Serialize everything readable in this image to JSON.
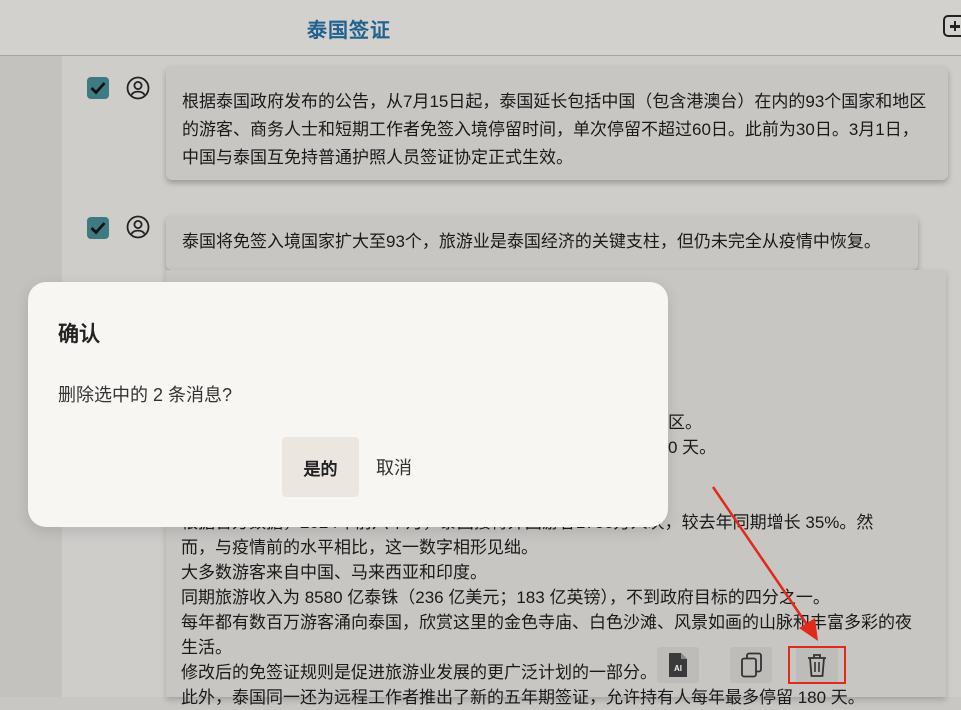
{
  "header": {
    "title": "泰国签证",
    "new_chat_icon": "plus-square-icon"
  },
  "messages": [
    {
      "text": "根据泰国政府发布的公告，从7月15日起，泰国延长包括中国（包含港澳台）在内的93个国家和地区的游客、商务人士和短期工作者免签入境停留时间，单次停留不超过60日。此前为30日。3月1日，中国与泰国互免持普通护照人员签证协定正式生效。",
      "checked": true
    },
    {
      "text": "泰国将免签入境国家扩大至93个，旅游业是泰国经济的关键支柱，但仍未完全从疫情中恢复。",
      "checked": true
    }
  ],
  "reply": {
    "fragment1": "区。",
    "fragment2": "0 天。",
    "para_partial": "根据官方数据，2024年前六个月，泰国接待外国游客1750万人次，较去年同期增长 35%。然",
    "para_lines": [
      "而，与疫情前的水平相比，这一数字相形见绌。",
      "大多数游客来自中国、马来西亚和印度。",
      "同期旅游收入为 8580 亿泰铢（236 亿美元；183 亿英镑），不到政府目标的四分之一。",
      "每年都有数百万游客涌向泰国，欣赏这里的金色寺庙、白色沙滩、风景如画的山脉和丰富多彩的夜",
      "生活。",
      "修改后的免签证规则是促进旅游业发展的更广泛计划的一部分。",
      "此外，泰国同一还为远程工作者推出了新的五年期签证，允许持有人每年最多停留 180 天。"
    ]
  },
  "actions": {
    "ai_label": "AI",
    "ai_icon": "ai-document-icon",
    "copy_icon": "copy-icon",
    "delete_icon": "trash-icon",
    "highlight_color": "#e02a1c"
  },
  "dialog": {
    "title": "确认",
    "message": "删除选中的 2 条消息?",
    "confirm_label": "是的",
    "cancel_label": "取消"
  }
}
